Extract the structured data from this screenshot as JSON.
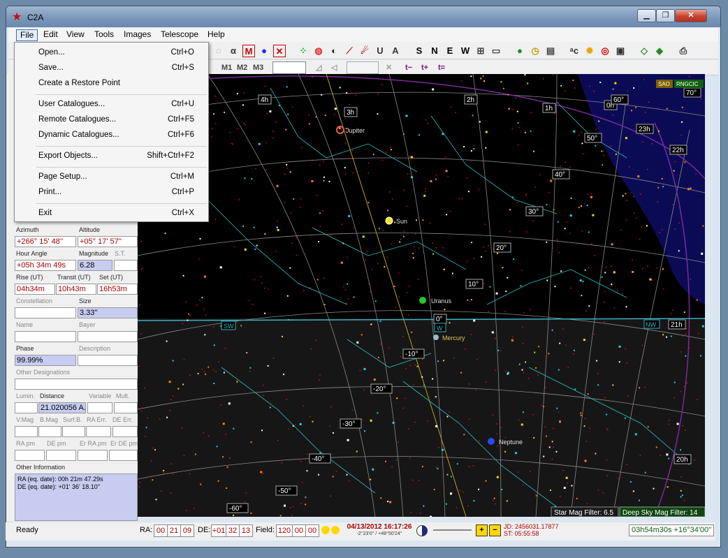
{
  "window": {
    "title": "C2A",
    "min": "▁",
    "max": "❐",
    "close": "✕"
  },
  "menu": [
    "File",
    "Edit",
    "View",
    "Tools",
    "Images",
    "Telescope",
    "Help"
  ],
  "file_menu": [
    {
      "label": "Open...",
      "shortcut": "Ctrl+O"
    },
    {
      "label": "Save...",
      "shortcut": "Ctrl+S"
    },
    {
      "label": "Create a Restore Point",
      "shortcut": ""
    },
    {
      "label": "User Catalogues...",
      "shortcut": "Ctrl+U"
    },
    {
      "label": "Remote Catalogues...",
      "shortcut": "Ctrl+F5"
    },
    {
      "label": "Dynamic Catalogues...",
      "shortcut": "Ctrl+F6"
    },
    {
      "label": "Export Objects...",
      "shortcut": "Shift+Ctrl+F2"
    },
    {
      "label": "Page Setup...",
      "shortcut": "Ctrl+M"
    },
    {
      "label": "Print...",
      "shortcut": "Ctrl+P"
    },
    {
      "label": "Exit",
      "shortcut": "Ctrl+X"
    }
  ],
  "toolbar2": {
    "m1": "M1",
    "m2": "M2",
    "m3": "M3",
    "tminus": "t−",
    "tplus": "t+",
    "tequal": "t="
  },
  "toolbar1_labels": [
    "S",
    "N",
    "E",
    "W"
  ],
  "panel": {
    "azimuth_label": "Azimuth",
    "altitude_label": "Altitude",
    "azimuth": "+266° 15' 48''",
    "altitude": "+05° 17' 57''",
    "hour_angle_label": "Hour Angle",
    "magnitude_label": "Magnitude",
    "st_label": "S.T.",
    "hour_angle": "+05h 34m 49s",
    "magnitude": "6.28",
    "rise_label": "Rise (UT)",
    "transit_label": "Transit (UT)",
    "set_label": "Set (UT)",
    "rise": "04h34m",
    "transit": "10h43m",
    "set": "16h53m",
    "constellation_label": "Constellation",
    "size_label": "Size",
    "size": "3.33''",
    "name_label": "Name",
    "bayer_label": "Bayer",
    "phase_label": "Phase",
    "description_label": "Description",
    "phase": "99.99%",
    "other_designations_label": "Other Designations",
    "lumin_label": "Lumin.",
    "distance_label": "Distance",
    "variable_label": "Variable",
    "mult_label": "Mult.",
    "distance": "21.020056 A.",
    "vmag_label": "V.Mag",
    "bmag_label": "B.Mag",
    "surfb_label": "Surf.B.",
    "raerr_label": "RA Err.",
    "deerr_label": "DE Err.",
    "rapm_label": "RA pm",
    "depm_label": "DE pm",
    "errapm_label": "Er RA pm",
    "erdepm_label": "Er DE pm",
    "other_info_label": "Other Information",
    "other_info_ra": "RA (eq. date): 00h 21m 47.29s",
    "other_info_de": "DE (eq. date): +01' 36' 18.10''"
  },
  "sky": {
    "planets": [
      "Jupiter",
      "Sun",
      "Uranus",
      "Mercury",
      "Neptune"
    ],
    "ra_labels": [
      "4h",
      "3h",
      "2h",
      "1h",
      "0h",
      "23h",
      "22h",
      "21h",
      "20h"
    ],
    "dec_labels": [
      "60°",
      "50°",
      "40°",
      "30°",
      "20°",
      "10°",
      "0°",
      "-10°",
      "-20°",
      "-30°",
      "-40°",
      "-50°",
      "-60°",
      "70°"
    ],
    "horizon_labels": [
      "SW",
      "W",
      "NW"
    ],
    "sao": "SAO",
    "rngcic": "RNGCIC",
    "star_filter": "Star Mag Filter: 6.5",
    "dso_filter": "Deep Sky Mag Filter: 14"
  },
  "status": {
    "ready": "Ready",
    "ra_label": "RA:",
    "ra_h": "00",
    "ra_m": "21",
    "ra_s": "09",
    "de_label": "DE:",
    "de_d": "+01",
    "de_m": "32",
    "de_s": "13",
    "field_label": "Field:",
    "field_d": "120",
    "field_m": "00",
    "field_s": "00",
    "datetime": "04/13/2012 16:17:26",
    "datetime_sub": "-2°23'0'' / +48°50'24''",
    "jd": "JD: 2456031.17877",
    "st": "ST: 05:55:58",
    "coords": "03h54m30s  +16°34'00''"
  },
  "colors": {
    "sky": "#000000",
    "star_red": "#e01010",
    "const_line": "#1ec8c8",
    "grid": "#c8c8c8",
    "blue_region": "#0a0a50"
  }
}
